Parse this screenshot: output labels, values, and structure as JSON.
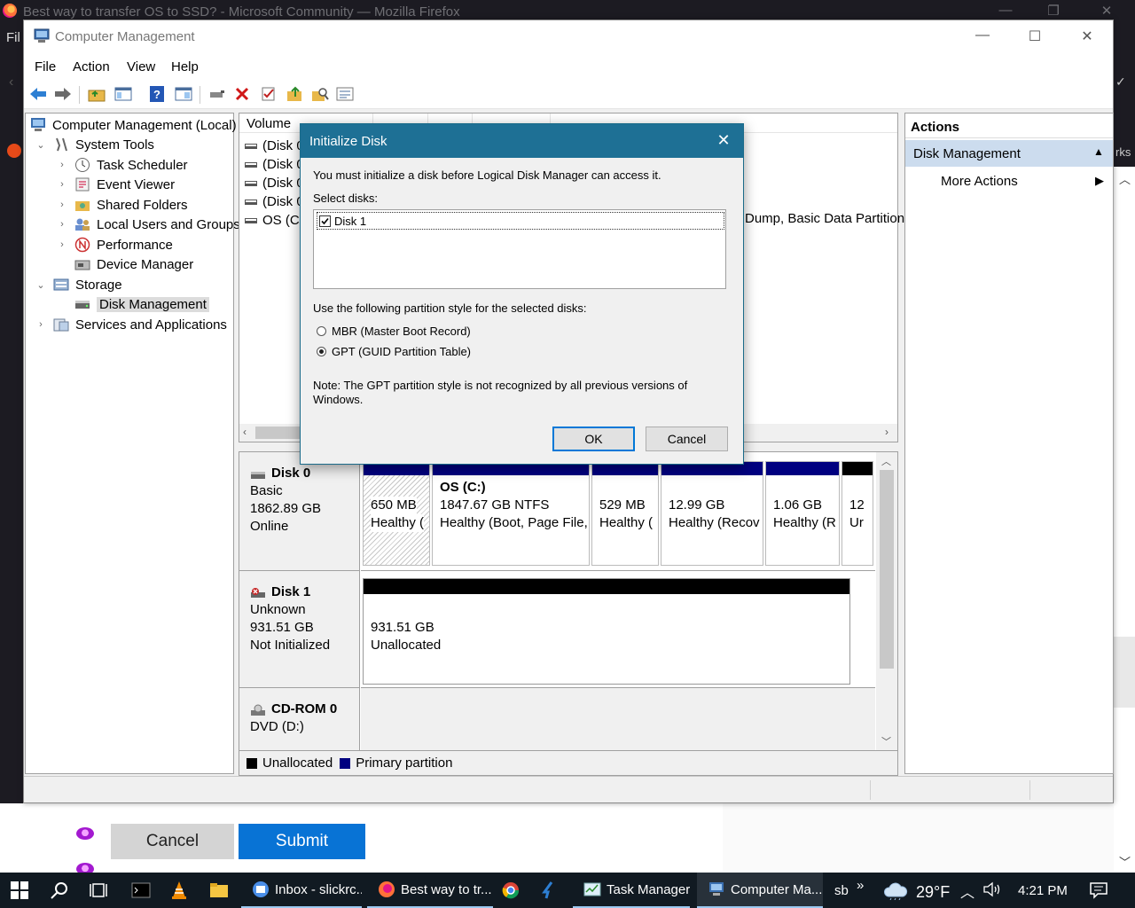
{
  "firefox": {
    "title": "Best way to transfer OS to SSD? - Microsoft Community — Mozilla Firefox",
    "menu_fragment": "Fil",
    "page_buttons": {
      "cancel": "Cancel",
      "submit": "Submit"
    }
  },
  "window": {
    "title": "Computer Management",
    "controls": {
      "minimize": "—",
      "maximize": "☐",
      "close": "✕"
    }
  },
  "menu": [
    "File",
    "Action",
    "View",
    "Help"
  ],
  "toolbar_icons": [
    "back-arrow-icon",
    "forward-arrow-icon",
    "up-folder-icon",
    "show-hide-tree-icon",
    "help-icon",
    "console-view-icon",
    "connect-icon",
    "delete-icon",
    "check-icon",
    "export-icon",
    "search-icon",
    "properties-icon"
  ],
  "tree": {
    "root": "Computer Management (Local)",
    "items": [
      {
        "label": "System Tools",
        "level": 1,
        "expander": "open"
      },
      {
        "label": "Task Scheduler",
        "level": 2,
        "expander": "closed"
      },
      {
        "label": "Event Viewer",
        "level": 2,
        "expander": "closed"
      },
      {
        "label": "Shared Folders",
        "level": 2,
        "expander": "closed"
      },
      {
        "label": "Local Users and Groups",
        "level": 2,
        "expander": "closed"
      },
      {
        "label": "Performance",
        "level": 2,
        "expander": "closed"
      },
      {
        "label": "Device Manager",
        "level": 2,
        "expander": "none"
      },
      {
        "label": "Storage",
        "level": 1,
        "expander": "open"
      },
      {
        "label": "Disk Management",
        "level": 2,
        "expander": "none",
        "selected": true
      },
      {
        "label": "Services and Applications",
        "level": 1,
        "expander": "closed"
      }
    ]
  },
  "volume_list": {
    "header": "Volume",
    "rows": [
      "(Disk 0",
      "(Disk 0",
      "(Disk 0",
      "(Disk 0",
      "OS (C:)"
    ],
    "visible_status": "Dump, Basic Data Partition"
  },
  "disks": [
    {
      "name": "Disk 0",
      "type": "Basic",
      "size": "1862.89 GB",
      "status": "Online",
      "partitions": [
        {
          "title": "",
          "size": "650 MB",
          "status": "Healthy ("
        },
        {
          "title": "OS  (C:)",
          "size": "1847.67 GB NTFS",
          "status": "Healthy (Boot, Page File,"
        },
        {
          "title": "",
          "size": "529 MB",
          "status": "Healthy ("
        },
        {
          "title": "",
          "size": "12.99 GB",
          "status": "Healthy (Recov"
        },
        {
          "title": "",
          "size": "1.06 GB",
          "status": "Healthy (R"
        },
        {
          "title": "",
          "size": "12",
          "status": "Ur"
        }
      ]
    },
    {
      "name": "Disk 1",
      "type": "Unknown",
      "size": "931.51 GB",
      "status": "Not Initialized",
      "partitions": [
        {
          "size": "931.51 GB",
          "status": "Unallocated"
        }
      ]
    },
    {
      "name": "CD-ROM 0",
      "type": "DVD (D:)"
    }
  ],
  "legend": [
    {
      "label": "Unallocated",
      "color": "#000000"
    },
    {
      "label": "Primary partition",
      "color": "#000080"
    }
  ],
  "actions": {
    "title": "Actions",
    "section": "Disk Management",
    "more": "More Actions"
  },
  "dialog": {
    "title": "Initialize Disk",
    "intro": "You must initialize a disk before Logical Disk Manager can access it.",
    "select_label": "Select disks:",
    "disk_item": "Disk 1",
    "style_label": "Use the following partition style for the selected disks:",
    "mbr": "MBR (Master Boot Record)",
    "gpt": "GPT (GUID Partition Table)",
    "note": "Note: The GPT partition style is not recognized by all previous versions of Windows.",
    "ok": "OK",
    "cancel": "Cancel"
  },
  "taskbar": {
    "apps": [
      {
        "label": "Inbox - slickrc..."
      },
      {
        "label": "Best way to tr..."
      },
      {
        "label": "Task Manager"
      },
      {
        "label": "Computer Ma..."
      }
    ],
    "tray_user": "sb",
    "tray_chevron": "»",
    "temperature": "29°F",
    "time": "4:21 PM"
  },
  "colors": {
    "primary_partition": "#000080",
    "dialog_title": "#1e7095",
    "submit_blue": "#0873d5",
    "taskbar": "#111a22"
  }
}
